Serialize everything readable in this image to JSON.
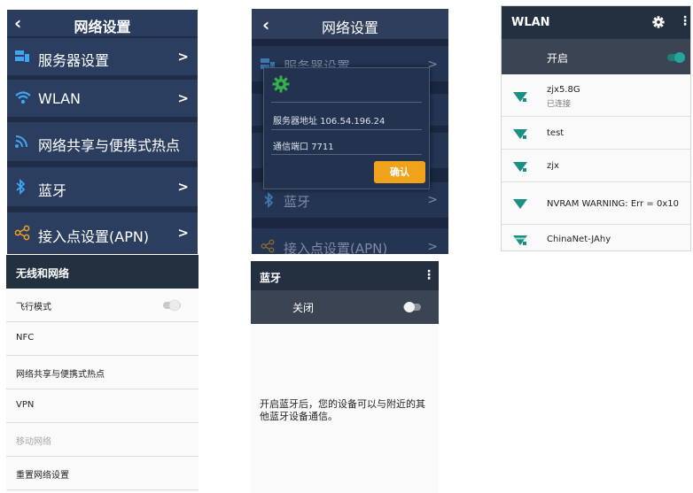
{
  "panel1": {
    "back_icon": "chevron-left-icon",
    "title": "网络设置",
    "items": [
      {
        "label": "服务器设置",
        "icon": "server-icon"
      },
      {
        "label": "WLAN",
        "icon": "wifi-icon"
      },
      {
        "label": "网络共享与便携式热点",
        "icon": "hotspot-icon"
      },
      {
        "label": "蓝牙",
        "icon": "bluetooth-icon"
      },
      {
        "label": "接入点设置(APN)",
        "icon": "share-node-icon"
      }
    ],
    "chevron": ">"
  },
  "panel2": {
    "title": "网络设置",
    "items": [
      {
        "label": "服务器设置"
      },
      {
        "label": "蓝牙"
      },
      {
        "label": "接入点设置(APN)"
      }
    ],
    "dialog": {
      "icon": "gear-icon",
      "server_address_label": "服务器地址",
      "server_address_value": "106.54.196.24",
      "port_label": "通信端口",
      "port_value": "7711",
      "confirm_label": "确认"
    }
  },
  "panel3": {
    "title": "WLAN",
    "toggle_label": "开启",
    "toggle_on": true,
    "accent_color": "#26a69a",
    "networks": [
      {
        "ssid": "zjx5.8G",
        "status": "已连接",
        "secured": true
      },
      {
        "ssid": "test",
        "status": "",
        "secured": true
      },
      {
        "ssid": "zjx",
        "status": "",
        "secured": true
      },
      {
        "ssid": "NVRAM WARNING: Err = 0x10",
        "status": "",
        "secured": false
      },
      {
        "ssid": "ChinaNet-JAhy",
        "status": "",
        "secured": true
      }
    ]
  },
  "panel4": {
    "title": "无线和网络",
    "items": [
      {
        "label": "飞行模式",
        "has_toggle": true,
        "enabled": true
      },
      {
        "label": "NFC",
        "has_toggle": false,
        "enabled": true
      },
      {
        "label": "网络共享与便携式热点",
        "has_toggle": false,
        "enabled": true
      },
      {
        "label": "VPN",
        "has_toggle": false,
        "enabled": true
      },
      {
        "label": "移动网络",
        "has_toggle": false,
        "enabled": false
      },
      {
        "label": "重置网络设置",
        "has_toggle": false,
        "enabled": true
      }
    ]
  },
  "panel5": {
    "title": "蓝牙",
    "toggle_label": "关闭",
    "toggle_on": false,
    "info_text": "开启蓝牙后，您的设备可以与附近的其他蓝牙设备通信。"
  }
}
